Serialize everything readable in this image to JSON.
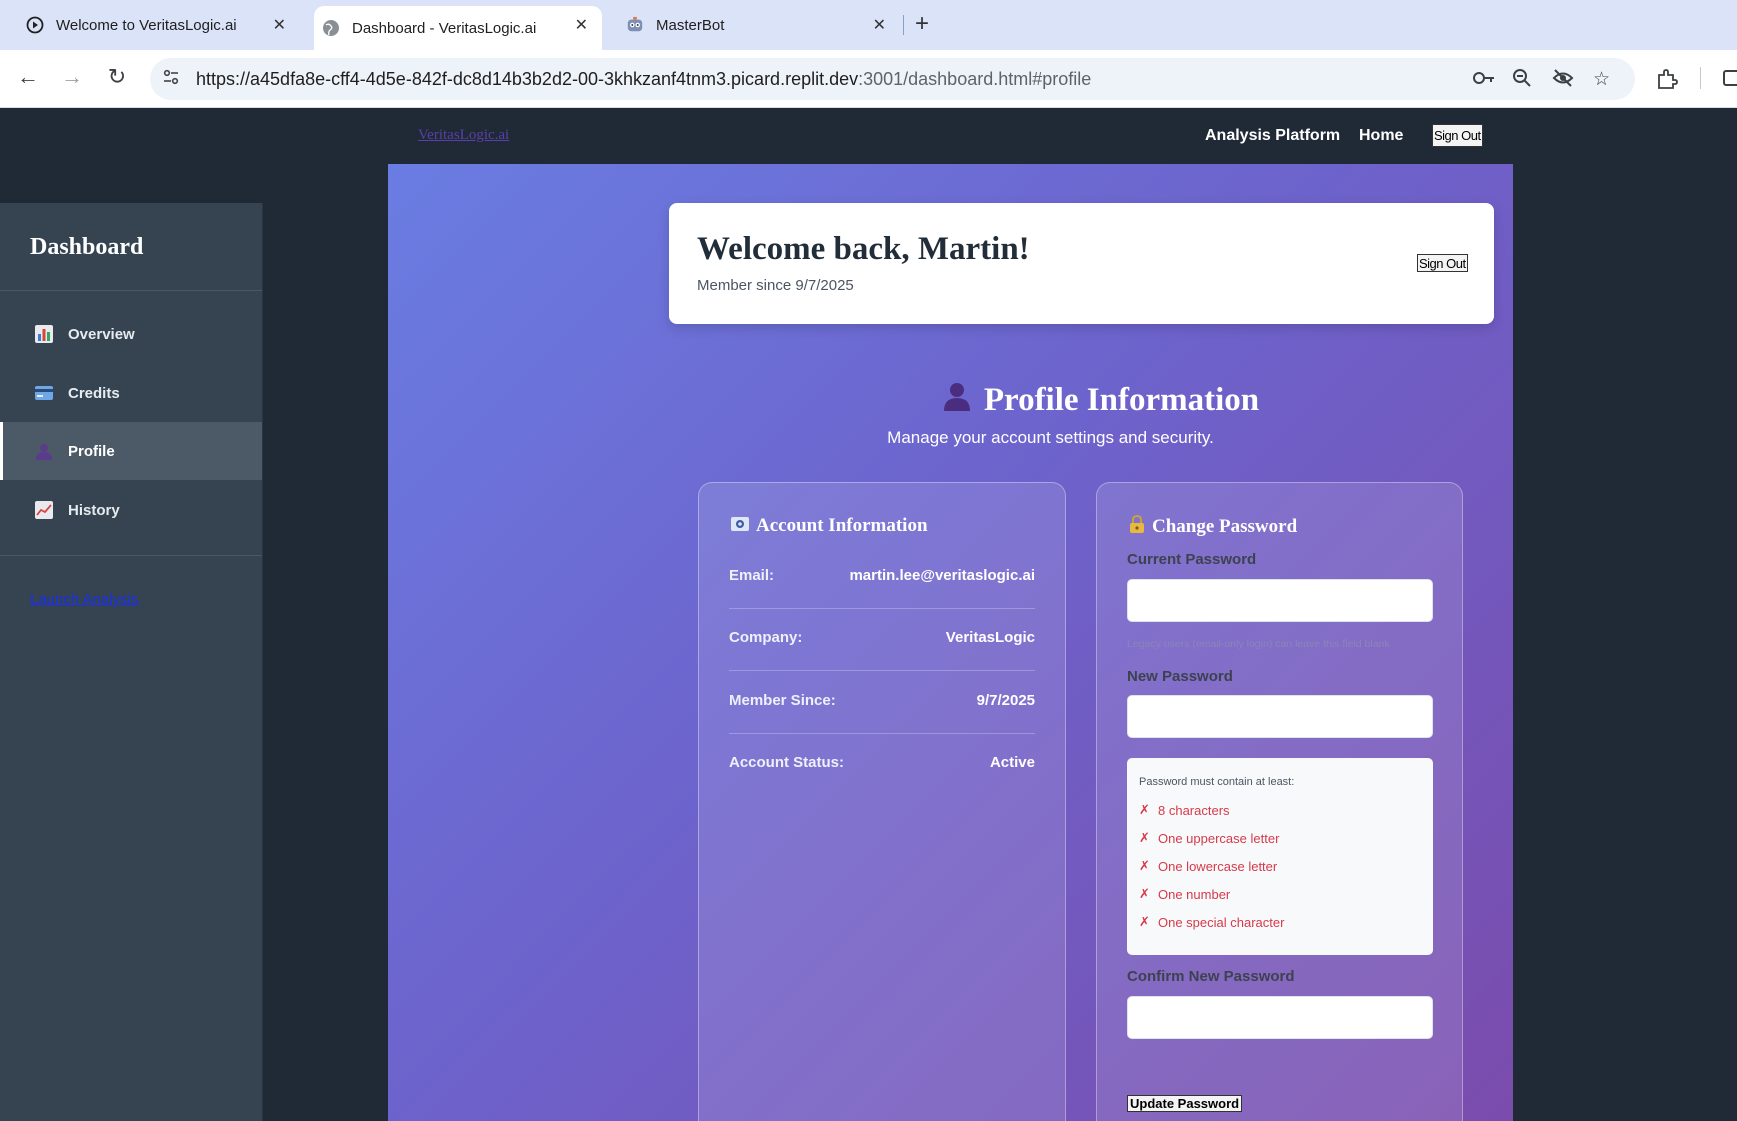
{
  "browser": {
    "tabs": [
      {
        "title": "Welcome to VeritasLogic.ai",
        "icon": "page-icon"
      },
      {
        "title": "Dashboard - VeritasLogic.ai",
        "icon": "globe-icon"
      },
      {
        "title": "MasterBot",
        "icon": "robot-icon"
      }
    ],
    "url_main": "https://a45dfa8e-cff4-4d5e-842f-dc8d14b3b2d2-00-3khkzanf4tnm3.picard.replit.dev",
    "url_rest": ":3001/dashboard.html#profile"
  },
  "header": {
    "brand": "VeritasLogic.ai",
    "nav": [
      "Analysis Platform",
      "Home"
    ],
    "signout": "Sign Out"
  },
  "sidebar": {
    "title": "Dashboard",
    "items": [
      {
        "label": "Overview",
        "icon": "bar-chart-icon"
      },
      {
        "label": "Credits",
        "icon": "credit-card-icon"
      },
      {
        "label": "Profile",
        "icon": "user-silhouette-icon",
        "active": true
      },
      {
        "label": "History",
        "icon": "line-chart-icon"
      }
    ],
    "launch": "Launch Analysis"
  },
  "welcome": {
    "title": "Welcome back, Martin!",
    "since": "Member since 9/7/2025",
    "signout": "Sign Out"
  },
  "profile": {
    "title": "Profile Information",
    "subtitle": "Manage your account settings and security."
  },
  "account": {
    "title": "Account Information",
    "rows": [
      {
        "key": "Email:",
        "value": "martin.lee@veritaslogic.ai"
      },
      {
        "key": "Company:",
        "value": "VeritasLogic"
      },
      {
        "key": "Member Since:",
        "value": "9/7/2025"
      },
      {
        "key": "Account Status:",
        "value": "Active"
      }
    ]
  },
  "password": {
    "title": "Change Password",
    "current_label": "Current Password",
    "current_hint": "Legacy users (email-only login) can leave this field blank",
    "new_label": "New Password",
    "req_header": "Password must contain at least:",
    "requirements": [
      "8 characters",
      "One uppercase letter",
      "One lowercase letter",
      "One number",
      "One special character"
    ],
    "req_mark": "✗",
    "confirm_label": "Confirm New Password",
    "update_button": "Update Password"
  }
}
